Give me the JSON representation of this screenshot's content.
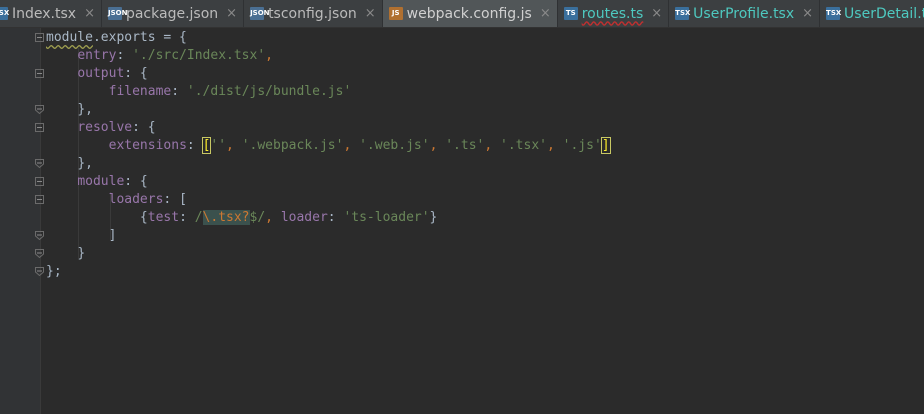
{
  "tabs": [
    {
      "name": "Index.tsx",
      "icon": "tsx-file-icon",
      "active": false
    },
    {
      "name": "package.json",
      "icon": "json-file-icon",
      "active": false
    },
    {
      "name": "tsconfig.json",
      "icon": "json-file-icon",
      "active": false
    },
    {
      "name": "webpack.config.js",
      "icon": "js-file-icon",
      "active": true
    },
    {
      "name": "routes.ts",
      "icon": "ts-file-icon",
      "active": false
    },
    {
      "name": "UserProfile.tsx",
      "icon": "tsx-file-icon",
      "active": false
    },
    {
      "name": "UserDetail.tsx",
      "icon": "tsx-file-icon",
      "active": false
    }
  ],
  "icon_labels": {
    "json": "JSON",
    "js": "JS",
    "ts": "TS",
    "tsx": "TSX"
  },
  "close_glyph": "×",
  "code": {
    "l1": {
      "a": "module",
      "b": ".exports = {"
    },
    "l2": {
      "key": "entry",
      "sep": ": ",
      "val": "'./src/Index.tsx'",
      "end": ","
    },
    "l3": {
      "key": "output",
      "end": ": {"
    },
    "l4": {
      "key": "filename",
      "sep": ": ",
      "val": "'./dist/js/bundle.js'"
    },
    "l5": {
      "text": "},"
    },
    "l6": {
      "key": "resolve",
      "end": ": {"
    },
    "l7": {
      "key": "extensions",
      "sep": ": ",
      "open": "[",
      "v1": "''",
      "c1": ", ",
      "v2": "'.webpack.js'",
      "c2": ", ",
      "v3": "'.web.js'",
      "c3": ", ",
      "v4": "'.ts'",
      "c4": ", ",
      "v5": "'.tsx'",
      "c5": ", ",
      "v6": "'.js'",
      "close": "]"
    },
    "l8": {
      "text": "},"
    },
    "l9": {
      "key": "module",
      "end": ": {"
    },
    "l10": {
      "key": "loaders",
      "end": ": ["
    },
    "l11": {
      "open": "{",
      "k1": "test",
      "s1": ": ",
      "rx1": "/",
      "rx2": "\\.tsx?",
      "rx3": "$/",
      "c1": ", ",
      "k2": "loader",
      "s2": ": ",
      "v2": "'ts-loader'",
      "close": "}"
    },
    "l12": {
      "text": "]"
    },
    "l13": {
      "text": "}"
    },
    "l14": {
      "text": "};"
    }
  },
  "colors": {
    "background": "#2b2b2b",
    "keyword": "#cc7832",
    "string": "#6a8759",
    "property": "#9876aa",
    "text": "#a9b7c6"
  }
}
